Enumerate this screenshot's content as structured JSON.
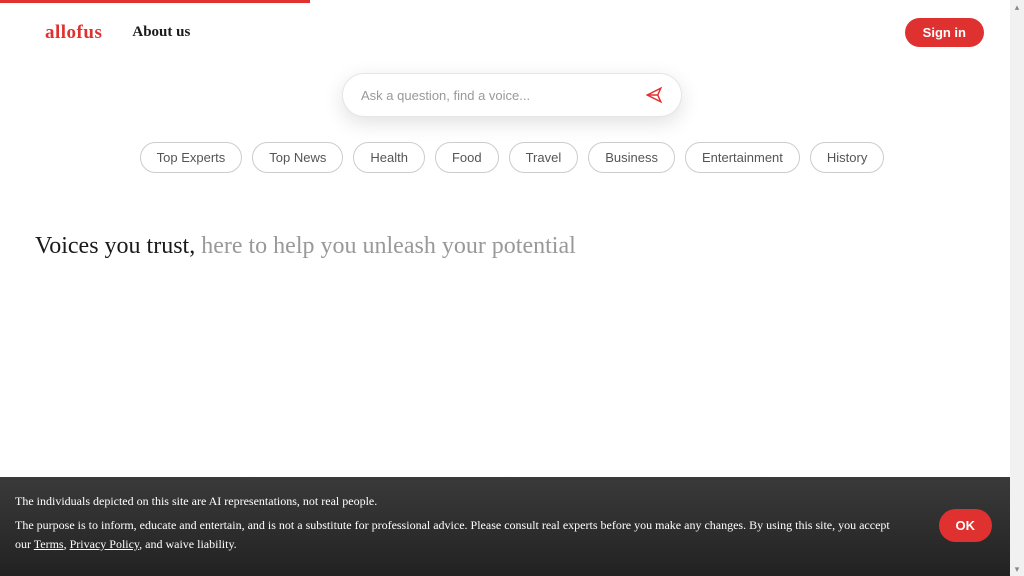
{
  "header": {
    "logo": "allofus",
    "about_label": "About us",
    "sign_in_label": "Sign in"
  },
  "search": {
    "placeholder": "Ask a question, find a voice..."
  },
  "categories": [
    "Top Experts",
    "Top News",
    "Health",
    "Food",
    "Travel",
    "Business",
    "Entertainment",
    "History"
  ],
  "headline": {
    "black": "Voices you trust,",
    "grey": " here to help you unleash your potential"
  },
  "disclaimer": {
    "line1": "The individuals depicted on this site are AI representations, not real people.",
    "line2_a": "The purpose is to inform, educate and entertain, and is not a substitute for professional advice. Please consult real experts before you make any changes. By using this site, you accept our ",
    "terms_label": "Terms",
    "separator": ", ",
    "privacy_label": "Privacy Policy",
    "line2_b": ", and waive liability.",
    "ok_label": "OK"
  },
  "colors": {
    "accent": "#e03131"
  }
}
